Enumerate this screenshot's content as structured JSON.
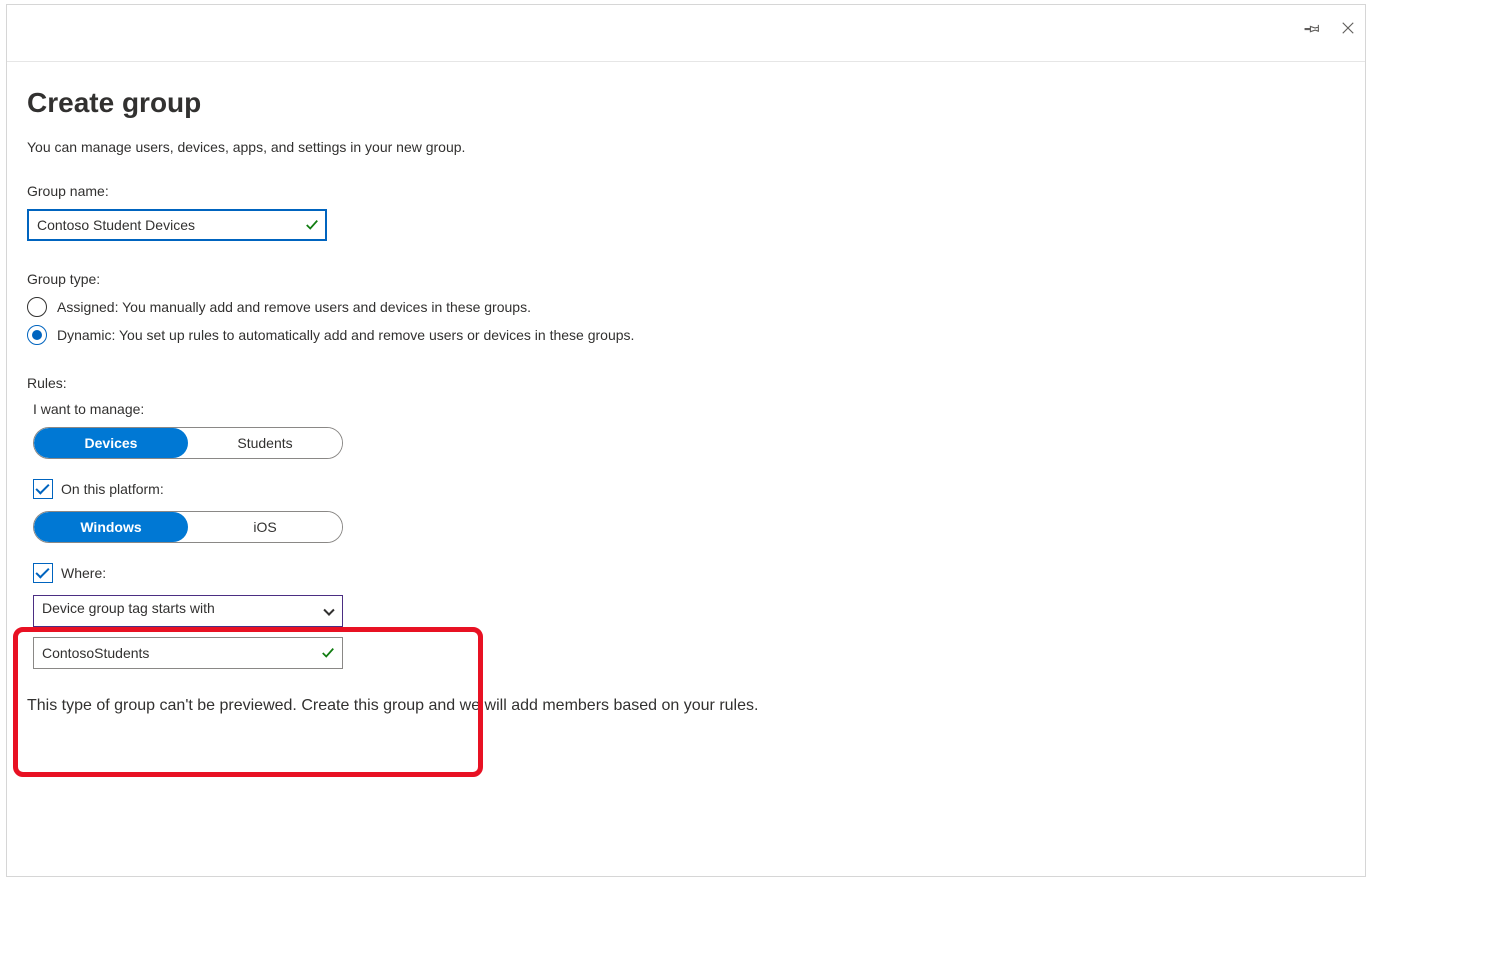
{
  "header": {
    "title": "Create group",
    "description": "You can manage users, devices, apps, and settings in your new group."
  },
  "groupName": {
    "label": "Group name:",
    "value": "Contoso Student Devices"
  },
  "groupType": {
    "label": "Group type:",
    "options": {
      "assigned": "Assigned: You manually add and remove users and devices in these groups.",
      "dynamic": "Dynamic: You set up rules to automatically add and remove users or devices in these groups."
    },
    "selected": "dynamic"
  },
  "rules": {
    "label": "Rules:",
    "manage": {
      "label": "I want to manage:",
      "options": {
        "devices": "Devices",
        "students": "Students"
      },
      "selected": "devices"
    },
    "platform": {
      "checked": true,
      "label": "On this platform:",
      "options": {
        "windows": "Windows",
        "ios": "iOS"
      },
      "selected": "windows"
    },
    "where": {
      "checked": true,
      "label": "Where:",
      "condition": "Device group tag starts with",
      "value": "ContosoStudents"
    }
  },
  "footer": "This type of group can't be previewed. Create this group and we will add members based on your rules."
}
